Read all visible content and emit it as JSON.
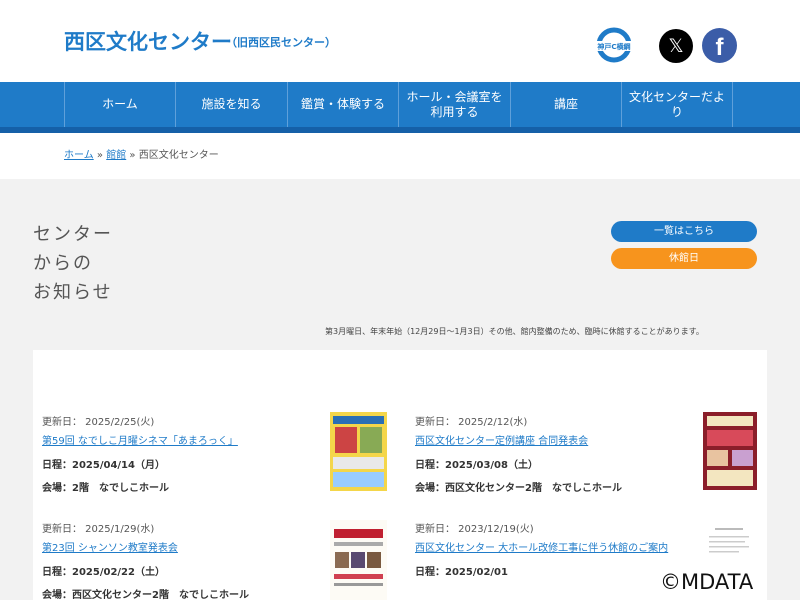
{
  "header": {
    "title": "西区文化センター",
    "subtitle": "（旧西区民センター）",
    "logo_text": "神戸C横綱",
    "x_glyph": "𝕏",
    "fb_glyph": "f"
  },
  "nav": {
    "items": [
      {
        "label": "ホーム"
      },
      {
        "label": "施設を知る"
      },
      {
        "label": "鑑賞・体験する"
      },
      {
        "label": "ホール・会議室を利用する"
      },
      {
        "label": "講座"
      },
      {
        "label": "文化センターだより"
      }
    ]
  },
  "breadcrumb": {
    "home": "ホーム",
    "sep": "»",
    "facilities": "館館",
    "current": "西区文化センター"
  },
  "news": {
    "heading_lines": [
      "センター",
      "からの",
      "お知らせ"
    ],
    "list_button": "一覧はこちら",
    "closed_button": "休館日",
    "closed_note": "第3月曜日、年末年始（12月29日〜1月3日）その他、館内整備のため、臨時に休館することがあります。",
    "cards": [
      {
        "updated": "更新日： 2025/2/25(火)",
        "title": "第59回 なでしこ月曜シネマ「あまろっく」",
        "date": "日程：2025/04/14（月）",
        "venue": "会場：2階　なでしこホール",
        "thumb": "movie-poster"
      },
      {
        "updated": "更新日： 2025/2/12(水)",
        "title": "西区文化センター定例講座 合同発表会",
        "date": "日程：2025/03/08（土）",
        "venue": "会場：西区文化センター2階　なでしこホール",
        "thumb": "recital-poster"
      },
      {
        "updated": "更新日： 2025/1/29(水)",
        "title": "第23回 シャンソン教室発表会",
        "date": "日程：2025/02/22（土）",
        "venue": "会場：西区文化センター2階　なでしこホール",
        "thumb": "chanson-poster"
      },
      {
        "updated": "更新日： 2023/12/19(火)",
        "title": "西区文化センター 大ホール改修工事に伴う休館のご案内",
        "date": "日程：2025/02/01",
        "venue": "",
        "thumb": "notice-document"
      }
    ]
  },
  "copyright": "©MDATA",
  "colors": {
    "brand_blue": "#1f7bc8",
    "orange": "#f7941d",
    "nav_dark": "#1560a8"
  }
}
